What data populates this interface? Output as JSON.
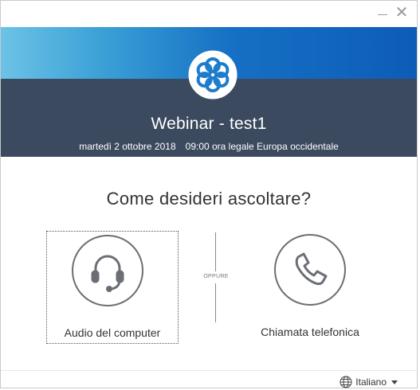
{
  "window": {
    "minimize_icon": "minimize-icon",
    "close_glyph": "✕"
  },
  "meeting": {
    "title": "Webinar - test1",
    "date": "martedì 2 ottobre 2018",
    "time": "09:00 ora legale Europa occidentale"
  },
  "prompt": {
    "question": "Come desideri ascoltare?",
    "separator": "OPPURE"
  },
  "options": {
    "computer": {
      "label": "Audio del computer",
      "icon": "headset-icon"
    },
    "phone": {
      "label": "Chiamata telefonica",
      "icon": "phone-icon"
    }
  },
  "footer": {
    "language": "Italiano",
    "language_icon": "globe-icon"
  },
  "colors": {
    "banner_dark": "#3b4a5e",
    "banner_blue": "#1670c4",
    "icon_stroke": "#6b6e75"
  }
}
